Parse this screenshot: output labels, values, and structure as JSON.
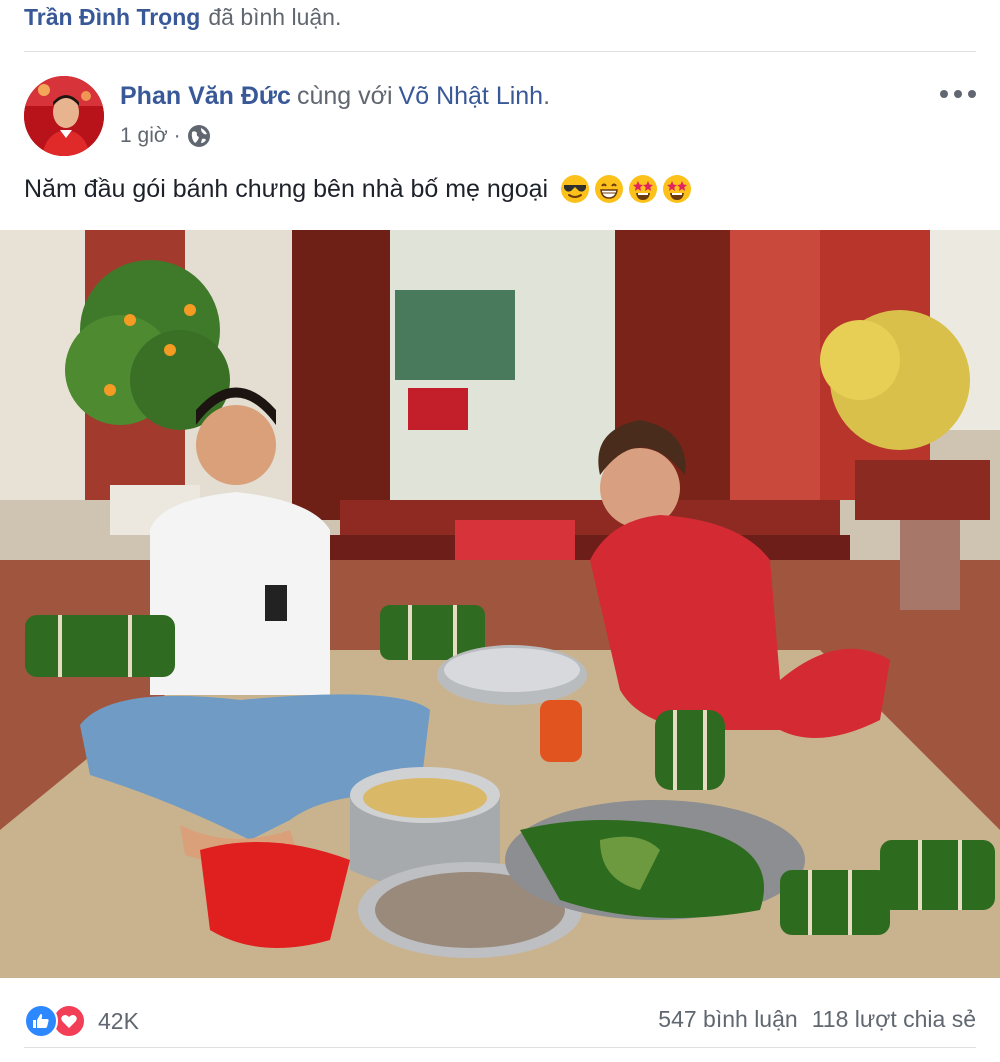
{
  "activity": {
    "actor": "Trần Đình Trọng",
    "action": "đã bình luận."
  },
  "post": {
    "author": "Phan Văn Đức",
    "with_text": "cùng với",
    "tagged": "Võ Nhật Linh",
    "tagged_end": ".",
    "time": "1 giờ",
    "separator": "·",
    "audience_icon": "globe-icon",
    "more_icon": "more-options-icon",
    "text": "Năm đầu gói bánh chưng bên nhà bố mẹ ngoại",
    "emojis": [
      "smiling-face-with-sunglasses",
      "grinning-face",
      "star-struck",
      "star-struck"
    ]
  },
  "footer": {
    "reaction_icons": [
      "like-icon",
      "love-icon"
    ],
    "reaction_count": "42K",
    "comments": "547 bình luận",
    "shares": "118 lượt chia sẻ"
  },
  "colors": {
    "link": "#385898",
    "secondary": "#616770",
    "like": "#2d88ff",
    "love": "#f33e58"
  }
}
